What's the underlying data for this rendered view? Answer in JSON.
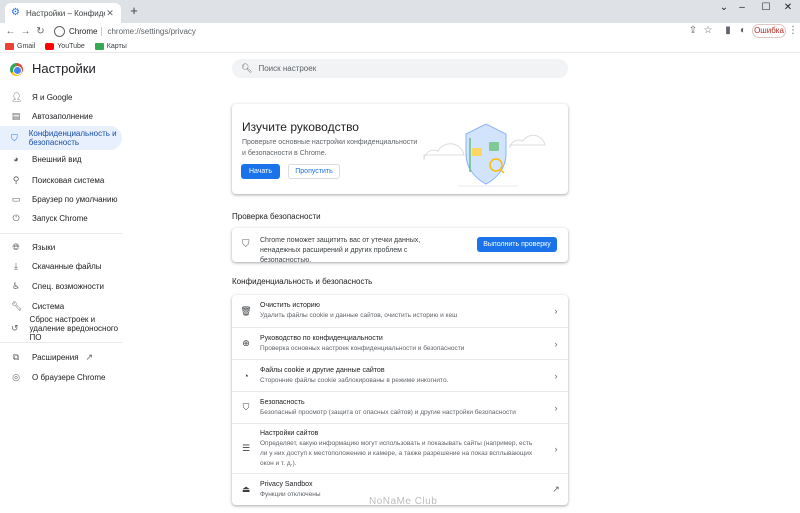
{
  "tab": {
    "title": "Настройки – Конфиденциальн",
    "favicon": "gear-icon"
  },
  "window": {
    "minimize": "–",
    "maximize": "☐",
    "close": "✕",
    "new_tab": "+",
    "tab_close": "✕",
    "tab_list": "⌄"
  },
  "toolbar": {
    "back": "←",
    "forward": "→",
    "reload": "↻",
    "site_name": "Chrome",
    "url": "chrome://settings/privacy",
    "share": "⇪",
    "bookmark": "☆",
    "sidepanel": "▮",
    "profile": "◐",
    "error_label": "Ошибка",
    "menu": "⋮"
  },
  "bookmarks": [
    {
      "label": "Gmail",
      "color": "#ea4335"
    },
    {
      "label": "YouTube",
      "color": "#ff0000"
    },
    {
      "label": "Карты",
      "color": "#34a853"
    }
  ],
  "header": {
    "title": "Настройки",
    "search_placeholder": "Поиск настроек"
  },
  "sidebar": {
    "items": [
      {
        "label": "Я и Google",
        "icon": "person-icon"
      },
      {
        "label": "Автозаполнение",
        "icon": "autofill-icon"
      },
      {
        "label": "Конфиденциальность и безопасность",
        "icon": "shield-icon",
        "active": true
      },
      {
        "label": "Внешний вид",
        "icon": "palette-icon"
      },
      {
        "label": "Поисковая система",
        "icon": "search-icon"
      },
      {
        "label": "Браузер по умолчанию",
        "icon": "browser-icon"
      },
      {
        "label": "Запуск Chrome",
        "icon": "power-icon"
      },
      {
        "label": "Языки",
        "icon": "globe-icon"
      },
      {
        "label": "Скачанные файлы",
        "icon": "download-icon"
      },
      {
        "label": "Спец. возможности",
        "icon": "accessibility-icon"
      },
      {
        "label": "Система",
        "icon": "wrench-icon"
      },
      {
        "label": "Сброс настроек и удаление вредоносного ПО",
        "icon": "reset-icon"
      },
      {
        "label": "Расширения",
        "icon": "puzzle-icon"
      },
      {
        "label": "О браузере Chrome",
        "icon": "chrome-icon"
      }
    ]
  },
  "guide": {
    "title": "Изучите руководство",
    "text": "Проверьте основные настройки конфиденциальности и безопасности в Chrome.",
    "start": "Начать",
    "skip": "Пропустить"
  },
  "safety": {
    "section_title": "Проверка безопасности",
    "text": "Chrome поможет защитить вас от утечки данных, ненадежных расширений и других проблем с безопасностью.",
    "button": "Выполнить проверку"
  },
  "privacy": {
    "section_title": "Конфиденциальность и безопасность",
    "rows": [
      {
        "title": "Очистить историю",
        "desc": "Удалить файлы cookie и данные сайтов, очистить историю и кеш"
      },
      {
        "title": "Руководство по конфиденциальности",
        "desc": "Проверка основных настроек конфиденциальности и безопасности"
      },
      {
        "title": "Файлы cookie и другие данные сайтов",
        "desc": "Сторонние файлы cookie заблокированы в режиме инкогнито."
      },
      {
        "title": "Безопасность",
        "desc": "Безопасный просмотр (защита от опасных сайтов) и другие настройки безопасности"
      },
      {
        "title": "Настройки сайтов",
        "desc": "Определяет, какую информацию могут использовать и показывать сайты (например, есть ли у них доступ к местоположению и камере, а также разрешение на показ всплывающих окон и т. д.)."
      },
      {
        "title": "Privacy Sandbox",
        "desc": "Функции отключены"
      }
    ]
  },
  "watermark": "NoNaMe Club",
  "colors": {
    "accent": "#1a73e8",
    "active_bg": "#e8f0fe",
    "tabstrip": "#dee1e6"
  }
}
